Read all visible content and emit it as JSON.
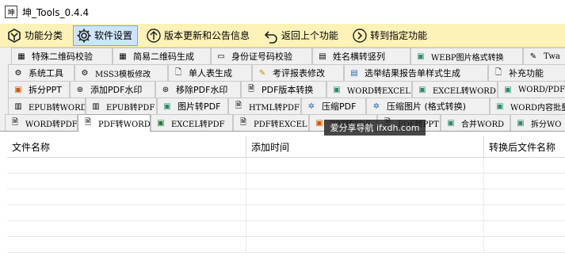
{
  "window": {
    "title": "坤_Tools_0.4.4",
    "icon": "app-logo-icon"
  },
  "toolbar": [
    {
      "label": "功能分类",
      "icon": "category-icon",
      "active": false
    },
    {
      "label": "软件设置",
      "icon": "gear-icon",
      "active": true
    },
    {
      "label": "版本更新和公告信息",
      "icon": "arrow-up-circle-icon",
      "active": false
    },
    {
      "label": "返回上个功能",
      "icon": "back-arrow-icon",
      "active": false
    },
    {
      "label": "转到指定功能",
      "icon": "arrow-right-circle-icon",
      "active": false
    }
  ],
  "tab_rows": [
    [
      {
        "label": "特殊二维码校验",
        "icon": "qr-code-icon"
      },
      {
        "label": "简易二维码生成",
        "icon": "qr-code-icon"
      },
      {
        "label": "身份证号码校验",
        "icon": "id-card-icon"
      },
      {
        "label": "姓名横转竖列",
        "icon": "table-icon"
      },
      {
        "label": "WEBP图片格式转换",
        "icon": "image-icon"
      },
      {
        "label": "Twa",
        "icon": "tools-icon"
      }
    ],
    [
      {
        "label": "系统工具",
        "icon": "gear-icon"
      },
      {
        "label": "MSS3模板修改",
        "icon": "gear-icon"
      },
      {
        "label": "单人表生成",
        "icon": "document-icon"
      },
      {
        "label": "考评报表修改",
        "icon": "edit-icon"
      },
      {
        "label": "选举结果报告单样式生成",
        "icon": "report-icon"
      },
      {
        "label": "补充功能",
        "icon": "document-icon"
      }
    ],
    [
      {
        "label": "拆分PPT",
        "icon": "ppt-icon"
      },
      {
        "label": "添加PDF水印",
        "icon": "watermark-icon"
      },
      {
        "label": "移除PDF水印",
        "icon": "watermark-icon"
      },
      {
        "label": "PDF版本转换",
        "icon": "pdf-icon"
      },
      {
        "label": "WORD转EXCEL",
        "icon": "convert-icon"
      },
      {
        "label": "EXCEL转WORD",
        "icon": "convert-icon"
      },
      {
        "label": "WORD/PDF/",
        "icon": "convert-icon"
      }
    ],
    [
      {
        "label": "EPUB转WORD",
        "icon": "book-icon"
      },
      {
        "label": "EPUB转PDF",
        "icon": "book-icon"
      },
      {
        "label": "图片转PDF",
        "icon": "image-icon"
      },
      {
        "label": "HTML转PDF",
        "icon": "pdf-icon"
      },
      {
        "label": "压缩PDF",
        "icon": "compress-icon"
      },
      {
        "label": "压缩图片 (格式转换)",
        "icon": "compress-icon"
      },
      {
        "label": "WORD内容批量",
        "icon": "convert-icon"
      }
    ],
    [
      {
        "label": "WORD转PDF",
        "icon": "pdf-icon"
      },
      {
        "label": "PDF转WORD",
        "icon": "pdf-icon",
        "selected": true
      },
      {
        "label": "EXCEL转PDF",
        "icon": "excel-icon"
      },
      {
        "label": "PDF转EXCEL",
        "icon": "pdf-icon"
      },
      {
        "label": "PPT转PDF",
        "icon": "ppt-icon"
      },
      {
        "label": "PDF转PPT",
        "icon": "pdf-icon"
      },
      {
        "label": "合并WORD",
        "icon": "merge-icon"
      },
      {
        "label": "拆分WO",
        "icon": "split-icon"
      }
    ]
  ],
  "watermark": "爱分享导航 ifxdh.com",
  "table": {
    "columns": [
      "文件名称",
      "添加时间",
      "转换后文件名称"
    ],
    "rows": [
      [
        "",
        "",
        ""
      ],
      [
        "",
        "",
        ""
      ],
      [
        "",
        "",
        ""
      ],
      [
        "",
        "",
        ""
      ],
      [
        "",
        "",
        ""
      ],
      [
        "",
        "",
        ""
      ]
    ]
  }
}
